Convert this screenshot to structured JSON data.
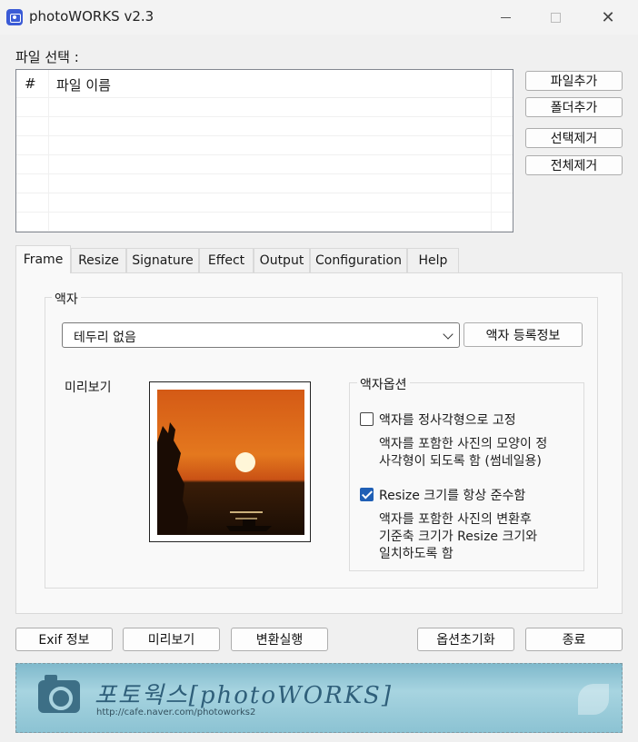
{
  "window": {
    "title": "photoWORKS v2.3"
  },
  "file_section": {
    "label": "파일 선택 :",
    "columns": [
      "#",
      "파일 이름"
    ],
    "buttons": {
      "add_file": "파일추가",
      "add_folder": "폴더추가",
      "remove_selected": "선택제거",
      "remove_all": "전체제거"
    }
  },
  "tabs": [
    {
      "label": "Frame",
      "active": true
    },
    {
      "label": "Resize"
    },
    {
      "label": "Signature"
    },
    {
      "label": "Effect"
    },
    {
      "label": "Output"
    },
    {
      "label": "Configuration"
    },
    {
      "label": "Help"
    }
  ],
  "frame_tab": {
    "group_title": "액자",
    "frame_select": {
      "value": "테두리 없음"
    },
    "register_button": "액자 등록정보",
    "preview_label": "미리보기",
    "options": {
      "title": "액자옵션",
      "square": {
        "label": "액자를 정사각형으로 고정",
        "checked": false,
        "desc_line1": "액자를 포함한 사진의 모양이 정",
        "desc_line2": "사각형이 되도록 함 (썸네일용)"
      },
      "resize": {
        "label": "Resize 크기를 항상 준수함",
        "checked": true,
        "desc_line1": "액자를 포함한 사진의 변환후",
        "desc_line2": "기준축 크기가 Resize 크기와",
        "desc_line3": "일치하도록 함"
      }
    }
  },
  "bottom_buttons": {
    "exif": "Exif 정보",
    "preview": "미리보기",
    "convert": "변환실행",
    "reset_options": "옵션초기화",
    "exit": "종료"
  },
  "banner": {
    "title": "포토웍스[photoWORKS]",
    "url": "http://cafe.naver.com/photoworks2"
  },
  "colors": {
    "accent": "#1f5fb5",
    "window_bg": "#f0f0f0",
    "panel_bg": "#f9f9f9"
  }
}
